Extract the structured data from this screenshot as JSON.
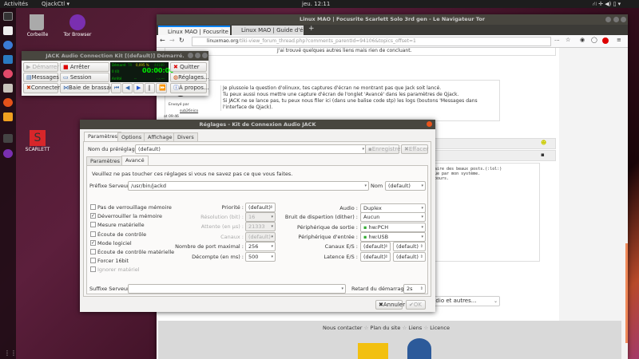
{
  "topbar": {
    "activities": "Activités",
    "app": "QjackCtl ▾",
    "clock": "jeu. 12:11",
    "tray": "⛙ ✛ ◀) ▯ ▾"
  },
  "desktop": {
    "trash": "Corbeille",
    "tor": "Tor Browser",
    "scarlett": "SCARLETT",
    "scarlett_letter": "S"
  },
  "browser": {
    "title": "Linux MAO | Focusrite Scarlett Solo 3rd gen - Le Navigateur Tor",
    "tabs": [
      {
        "label": "Linux MAO | Focusrite S"
      },
      {
        "label": "Linux MAO | Guide d'édi"
      }
    ],
    "new_tab": "+",
    "url_host": "linuxmao.org",
    "url_path": "/tiki-view_forum_thread.php?comments_parentId=94106&topics_offset=1",
    "prev_post": "J'ai trouvé quelques autres liens mais rien de concluant.",
    "post": {
      "lines": [
        "Je plussoie la question d'olinuxx, tes captures d'écran ne montrant pas que Jack soit lancé.",
        "Tu peux aussi nous mettre une capture d'écran de l'onglet 'Avancé' dans les paramètres de Qjack.",
        "Si JACK ne se lance pas, tu peux nous filer ici (dans une balise code stp) les logs (boutons 'Messages dans l'interface de Qjack)."
      ],
      "sent_by": "Envoyé par",
      "author": "sub26nico",
      "time": "at 09:46"
    },
    "code_lines": [
      "faire des beaux posts.(:lol:)",
      "nue par mon système.",
      "ibours."
    ],
    "select": "udio et autres...",
    "footer": [
      "Nous contacter",
      "Plan du site",
      "Liens",
      "Licence"
    ],
    "footer_sep": "☆"
  },
  "jack": {
    "title": "JACK Audio Connection Kit [(default)] Démarré.",
    "buttons": {
      "start": "Démarrer",
      "stop": "Arrêter",
      "quit": "Quitter",
      "messages": "Messages",
      "session": "Session",
      "settings": "Réglages...",
      "connect": "Connecter",
      "patchbay": "Baie de brassage",
      "about": "À propos..."
    },
    "display": {
      "status": "Démarré",
      "rt": "TR",
      "dsp": "0,095 %",
      "rate": "44100 Hz",
      "xruns": "0 (0)",
      "time": "00:00:00",
      "transport": "Arrêté",
      "dash": "--",
      "bbt": "-.-.---"
    }
  },
  "dialog": {
    "title": "Réglages - Kit de Connexion Audio JACK",
    "tabs": [
      "Paramètres",
      "Options",
      "Affichage",
      "Divers"
    ],
    "preset_label": "Nom du préréglage :",
    "preset_value": "(default)",
    "save": "Enregistrer",
    "clear": "Effacer",
    "subtabs": [
      "Paramètres",
      "Avancé"
    ],
    "warning": "Veuillez ne pas toucher ces réglages si vous ne savez pas ce que vous faites.",
    "prefix_label": "Préfixe Serveur :",
    "prefix_value": "/usr/bin/jackd",
    "name_label": "Nom :",
    "name_value": "(default)",
    "checkboxes": [
      {
        "label": "Pas de verrouillage mémoire",
        "checked": false,
        "enabled": true
      },
      {
        "label": "Déverrouiller la mémoire",
        "checked": true,
        "enabled": true
      },
      {
        "label": "Mesure matérielle",
        "checked": false,
        "enabled": true
      },
      {
        "label": "Écoute de contrôle",
        "checked": false,
        "enabled": true
      },
      {
        "label": "Mode logiciel",
        "checked": true,
        "enabled": true
      },
      {
        "label": "Écoute de contrôle matérielle",
        "checked": false,
        "enabled": true
      },
      {
        "label": "Forcer 16bit",
        "checked": false,
        "enabled": true
      },
      {
        "label": "Ignorer matériel",
        "checked": false,
        "enabled": false
      }
    ],
    "mid": [
      {
        "label": "Priorité :",
        "value": "(default)",
        "enabled": true
      },
      {
        "label": "Résolution (bit) :",
        "value": "16",
        "enabled": false
      },
      {
        "label": "Attente (en µs) :",
        "value": "21333",
        "enabled": false
      },
      {
        "label": "Canaux :",
        "value": "(default)",
        "enabled": false
      },
      {
        "label": "Nombre de port maximal :",
        "value": "256",
        "enabled": true
      },
      {
        "label": "Décompte (en ms) :",
        "value": "500",
        "enabled": true
      }
    ],
    "right": [
      {
        "label": "Audio :",
        "value": "Duplex"
      },
      {
        "label": "Bruit de dispertion (dither) :",
        "value": "Aucun"
      },
      {
        "label": "Périphérique de sortie :",
        "value": "hw:PCH"
      },
      {
        "label": "Périphérique d'entrée :",
        "value": "hw:USB"
      },
      {
        "label": "Canaux E/S :",
        "value": "(default)",
        "value2": "(default)"
      },
      {
        "label": "Latence E/S :",
        "value": "(default)",
        "value2": "(default)"
      }
    ],
    "suffix_label": "Suffixe Serveur :",
    "suffix_value": "",
    "delay_label": "Retard du démarrage :",
    "delay_value": "2s",
    "cancel": "Annuler",
    "ok": "OK"
  }
}
